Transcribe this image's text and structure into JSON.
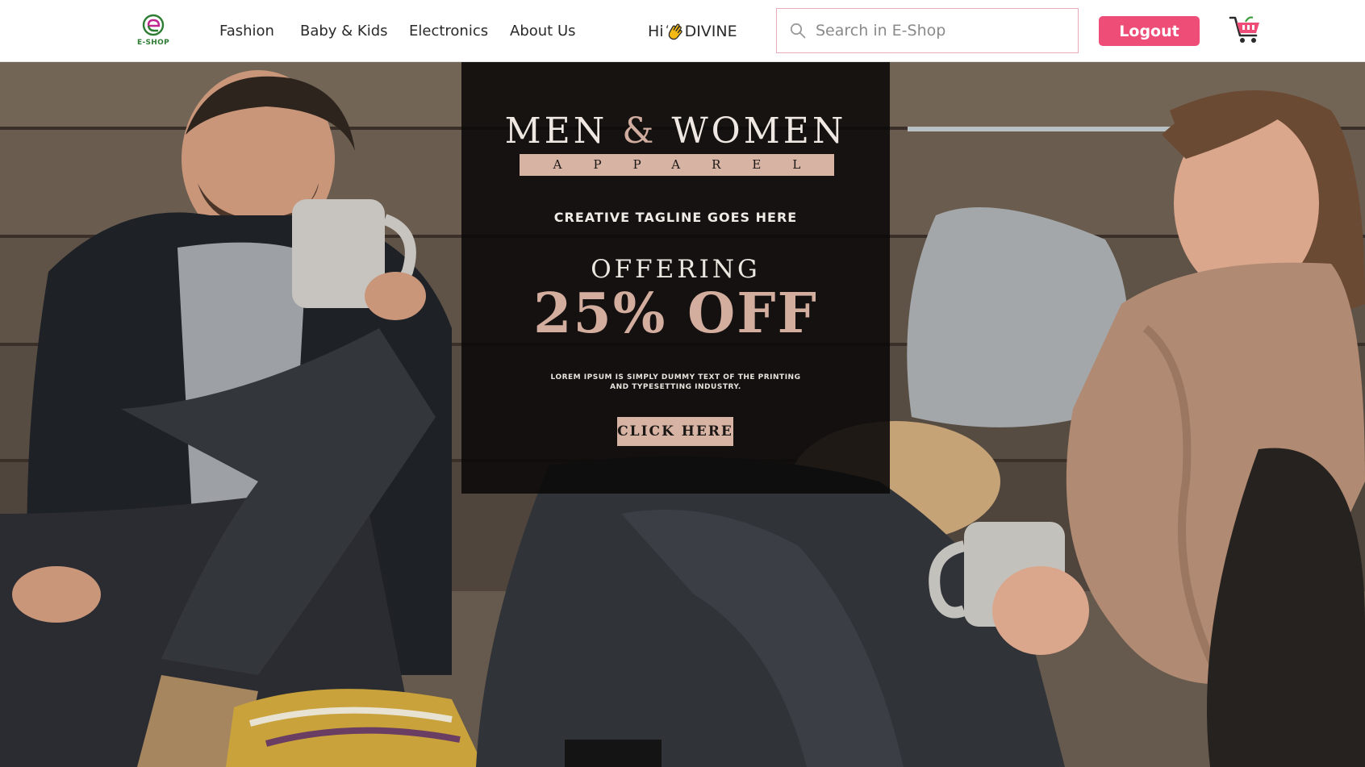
{
  "brand": {
    "logo_text": "E-SHOP",
    "accent_color": "#ee4d77",
    "logo_color": "#2f7d35"
  },
  "nav": {
    "links": [
      "Fashion",
      "Baby & Kids",
      "Electronics",
      "About Us"
    ]
  },
  "user": {
    "greeting_prefix": "Hi",
    "name": "DIVINE",
    "wave_icon": "waving-hand-icon"
  },
  "search": {
    "placeholder": "Search in E-Shop",
    "value": "",
    "icon": "search-icon"
  },
  "header": {
    "logout_label": "Logout",
    "cart_icon": "shopping-cart-icon"
  },
  "hero": {
    "banner": {
      "title_left": "MEN",
      "title_amp": "&",
      "title_right": "WOMEN",
      "subtitle": "APPAREL",
      "tagline": "CREATIVE TAGLINE GOES HERE",
      "offering": "OFFERING",
      "discount": "25% OFF",
      "body": "LOREM IPSUM IS SIMPLY DUMMY TEXT OF THE PRINTING AND TYPESETTING INDUSTRY.",
      "cta_label": "CLICK HERE"
    },
    "accent_color": "#d7b3a4"
  }
}
